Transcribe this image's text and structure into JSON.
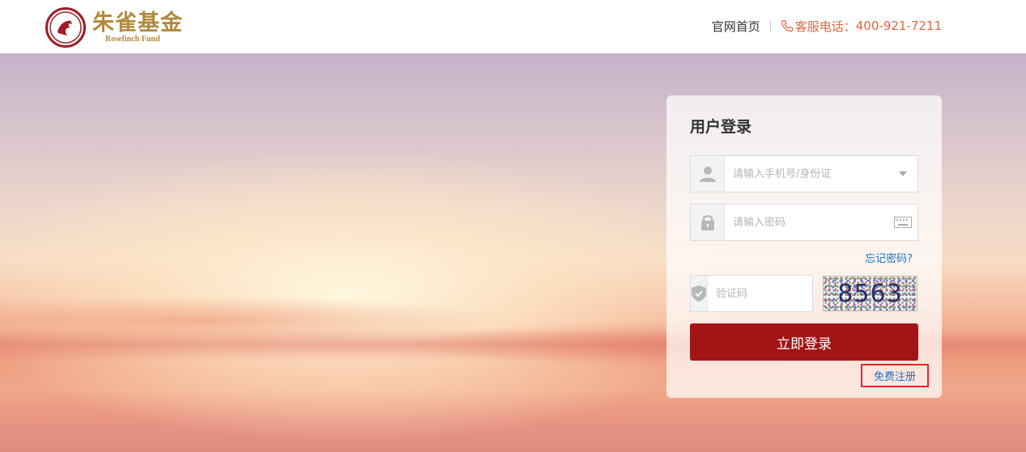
{
  "header": {
    "logo_cn": "朱雀基金",
    "logo_en": "Rosefinch Fund",
    "home_link": "官网首页",
    "phone_label": "客服电话：",
    "phone_number": "400-921-7211"
  },
  "login": {
    "title": "用户登录",
    "username_placeholder": "请输入手机号/身份证",
    "password_placeholder": "请输入密码",
    "forgot_password": "忘记密码?",
    "captcha_placeholder": "验证码",
    "captcha_code": "8563",
    "submit_label": "立即登录",
    "register_label": "免费注册"
  },
  "colors": {
    "brand_red": "#a31515",
    "accent_orange": "#e8643b",
    "link_blue": "#1a73c8",
    "logo_gold": "#b08a3e"
  },
  "icons": [
    "rosefinch-logo-icon",
    "phone-icon",
    "user-icon",
    "dropdown-arrow-icon",
    "lock-icon",
    "keyboard-icon",
    "shield-icon"
  ]
}
